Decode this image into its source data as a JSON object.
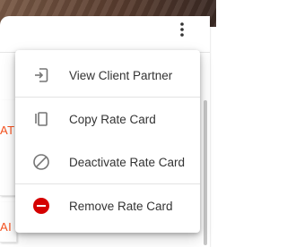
{
  "background": {
    "stub_one_text": "ATE",
    "stub_two_text": "AI"
  },
  "toolbar": {
    "more_icon": "more-vert-icon"
  },
  "menu": {
    "items": [
      {
        "label": "View Client Partner",
        "icon": "open-in-icon"
      },
      {
        "label": "Copy Rate Card",
        "icon": "copy-icon"
      },
      {
        "label": "Deactivate Rate Card",
        "icon": "block-icon"
      },
      {
        "label": "Remove Rate Card",
        "icon": "remove-circle-icon",
        "icon_color": "#d50000"
      }
    ]
  }
}
